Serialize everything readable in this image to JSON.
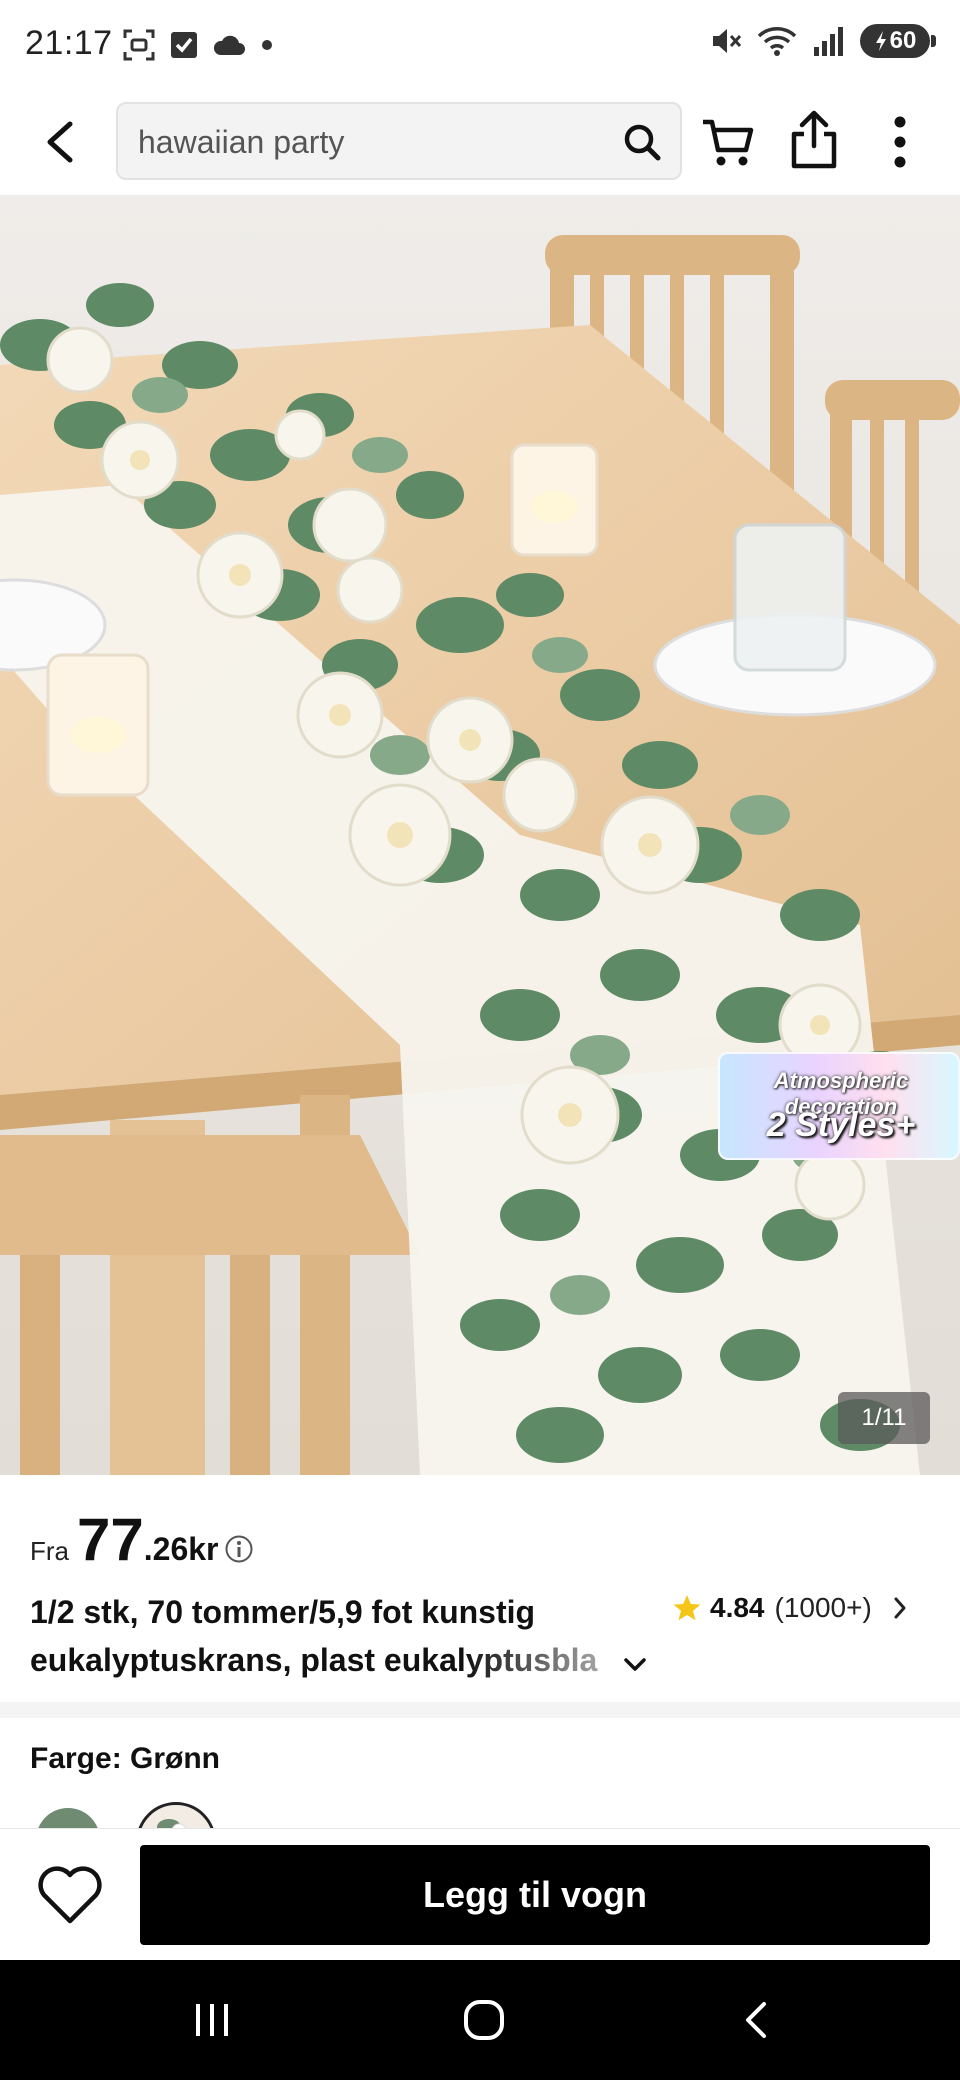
{
  "status_bar": {
    "time": "21:17",
    "battery": "60"
  },
  "search": {
    "value": "hawaiian party"
  },
  "gallery": {
    "counter": "1/11",
    "badge_line1": "Atmospheric decoration",
    "badge_line2": "2 Styles+"
  },
  "product": {
    "price_prefix": "Fra",
    "price_major": "77",
    "price_minor": ".26kr",
    "title_line1": "1/2 stk, 70 tommer/5,9 fot kunstig",
    "title_line2": "eukalyptuskrans, plast eukalyptusbla",
    "rating_value": "4.84",
    "rating_count": "(1000+)",
    "color_label": "Farge: Grønn"
  },
  "actions": {
    "add_to_cart": "Legg til vogn"
  },
  "colors": {
    "primary_button": "#000000",
    "star": "#f5c518",
    "swatch_green": "#6f8c73"
  }
}
